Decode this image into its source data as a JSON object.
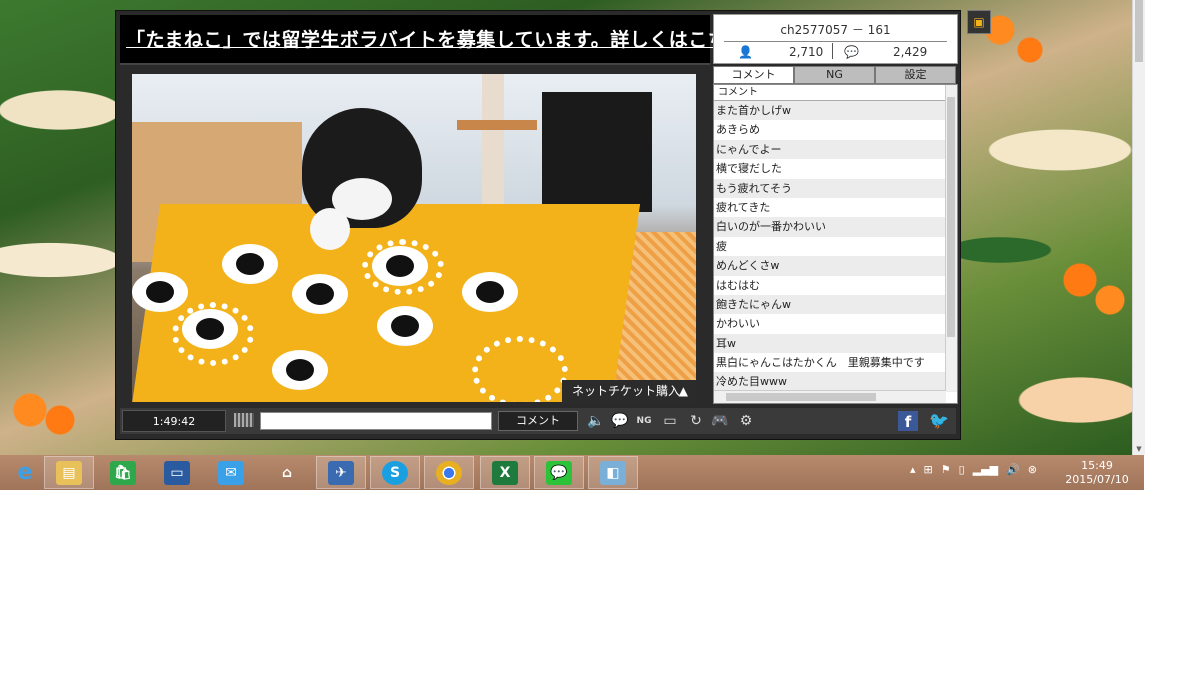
{
  "banner": {
    "text": "「たまねこ」では留学生ボラバイトを募集しています。詳しくはこちら！"
  },
  "info": {
    "channel": "ch2577057 － 161",
    "viewers": "2,710",
    "comment_count": "2,429"
  },
  "tabs": [
    "コメント",
    "NG",
    "設定"
  ],
  "comment_list": {
    "header": "コメント",
    "items": [
      "また首かしげw",
      "あきらめ",
      "にゃんでよー",
      "横で寝だした",
      "もう疲れてそう",
      "疲れてきた",
      "白いのが一番かわいい",
      "疲",
      "めんどくさw",
      "はむはむ",
      "飽きたにゃんw",
      "かわいい",
      "耳w",
      "黒白にゃんこはたかくん　里親募集中です",
      "冷めた目www"
    ]
  },
  "video": {
    "ticket_label": "ネットチケット購入"
  },
  "controls": {
    "time": "1:49:42",
    "comment_button": "コメント",
    "comment_placeholder": ""
  },
  "taskbar": {
    "items": [
      "ie-icon",
      "file-explorer-icon",
      "store-icon",
      "lenovo-icon",
      "mail-icon",
      "home-icon",
      "thunderbird-icon",
      "skype-icon",
      "chrome-icon",
      "excel-icon",
      "line-icon",
      "app-icon"
    ]
  },
  "tray": {
    "time": "15:49",
    "date": "2015/07/10"
  }
}
